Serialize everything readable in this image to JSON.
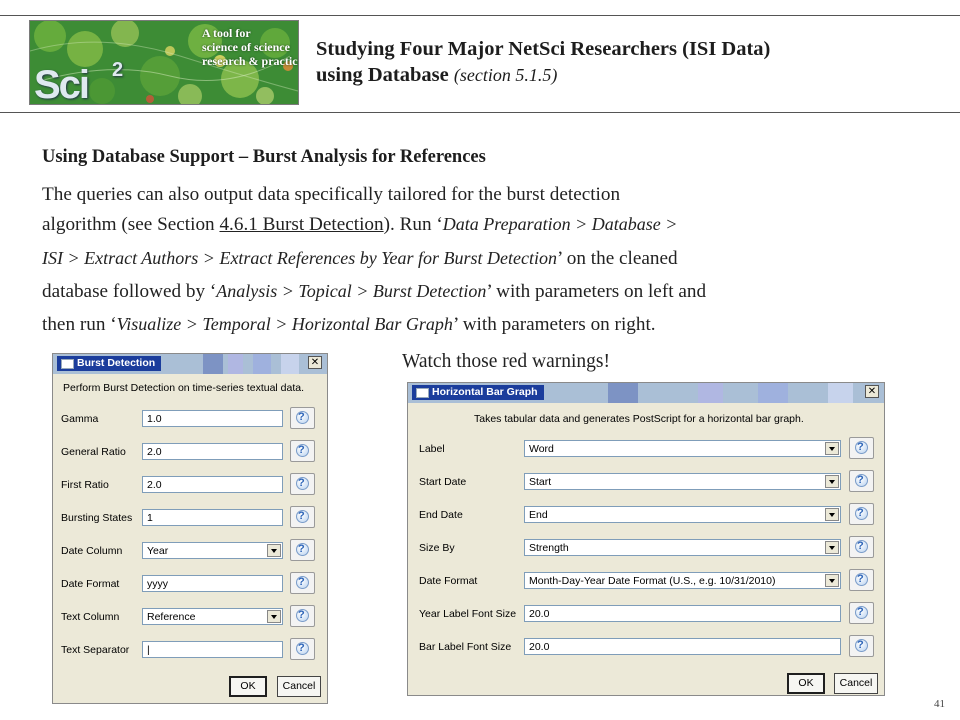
{
  "header": {
    "title_line1": "Studying Four Major NetSci Researchers (ISI Data)",
    "title_line2_main": "using Database",
    "title_line2_sub": "(section 5.1.5)",
    "logo": {
      "text": "Sci2",
      "tagline_lines": [
        "A tool for",
        "science of science",
        "research & practice"
      ],
      "colors": {
        "base": "#3d8c35",
        "accent": "#8fc84a"
      }
    }
  },
  "body": {
    "subheading": "Using Database Support – Burst Analysis for References",
    "paragraph": {
      "l1": "The queries can also output data specifically tailored for the burst detection",
      "l2_a": "algorithm (see Section ",
      "l2_link": "4.6.1 Burst Detection",
      "l2_b": ").  Run ‘",
      "l2_c": "Data Preparation > Database >",
      "l3_a": "ISI > Extract Authors > Extract References by Year for Burst Detection",
      "l3_b": "’ on the cleaned",
      "l4_a": "database followed by ‘",
      "l4_b": "Analysis > Topical > Burst Detection",
      "l4_c": "’ with parameters on left and",
      "l5_a": "then run ‘",
      "l5_b": "Visualize > Temporal > Horizontal Bar Graph",
      "l5_c": "’ with parameters on right."
    },
    "warning": "Watch those red warnings!",
    "page_number": "41"
  },
  "burst_dialog": {
    "title": "Burst Detection",
    "description": "Perform Burst Detection on time-series textual data.",
    "fields": [
      {
        "label": "Gamma",
        "value": "1.0",
        "kind": "text"
      },
      {
        "label": "General Ratio",
        "value": "2.0",
        "kind": "text"
      },
      {
        "label": "First Ratio",
        "value": "2.0",
        "kind": "text"
      },
      {
        "label": "Bursting States",
        "value": "1",
        "kind": "text"
      },
      {
        "label": "Date Column",
        "value": "Year",
        "kind": "select"
      },
      {
        "label": "Date Format",
        "value": "yyyy",
        "kind": "text"
      },
      {
        "label": "Text Column",
        "value": "Reference",
        "kind": "select"
      },
      {
        "label": "Text Separator",
        "value": "|",
        "kind": "text"
      }
    ],
    "ok": "OK",
    "cancel": "Cancel",
    "close_glyph": "✕"
  },
  "hbar_dialog": {
    "title": "Horizontal Bar Graph",
    "description": "Takes tabular data and generates PostScript for a horizontal bar graph.",
    "fields": [
      {
        "label": "Label",
        "value": "Word",
        "kind": "select"
      },
      {
        "label": "Start Date",
        "value": "Start",
        "kind": "select"
      },
      {
        "label": "End Date",
        "value": "End",
        "kind": "select"
      },
      {
        "label": "Size By",
        "value": "Strength",
        "kind": "select"
      },
      {
        "label": "Date Format",
        "value": "Month-Day-Year Date Format (U.S., e.g. 10/31/2010)",
        "kind": "select"
      },
      {
        "label": "Year Label Font Size",
        "value": "20.0",
        "kind": "text"
      },
      {
        "label": "Bar Label Font Size",
        "value": "20.0",
        "kind": "text"
      }
    ],
    "ok": "OK",
    "cancel": "Cancel",
    "close_glyph": "✕"
  }
}
